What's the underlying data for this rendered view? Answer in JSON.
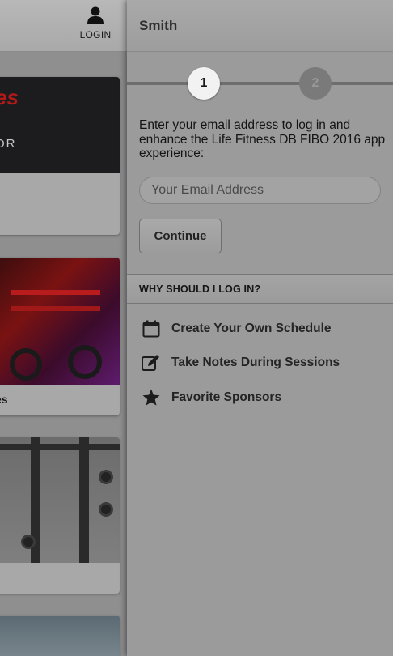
{
  "left_pane": {
    "login_label": "LOGIN",
    "login_icon": "person-icon",
    "cards": [
      {
        "brand_text": "es",
        "tagline": "OR"
      },
      {
        "caption": "es"
      },
      {},
      {}
    ]
  },
  "panel": {
    "title": "Smith",
    "steps": [
      "1",
      "2"
    ],
    "intro_text": "Enter your email address to log in and enhance the Life Fitness DB FIBO 2016 app experience:",
    "email_placeholder": "Your Email Address",
    "continue_label": "Continue",
    "why_heading": "WHY SHOULD I LOG IN?",
    "benefits": [
      {
        "icon": "calendar-icon",
        "label": "Create Your Own Schedule"
      },
      {
        "icon": "edit-icon",
        "label": "Take Notes During Sessions"
      },
      {
        "icon": "star-icon",
        "label": "Favorite Sponsors"
      }
    ]
  },
  "colors": {
    "overlay_gray": "#9b9b9b",
    "brand_red": "#b21a1a",
    "active_step": "#f2f2f2",
    "inactive_step": "#7a7a7a"
  }
}
